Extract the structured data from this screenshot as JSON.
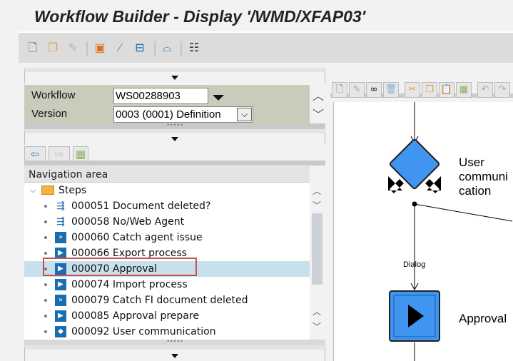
{
  "title": "Workflow Builder - Display '/WMD/XFAP03'",
  "toolbar": {
    "icons": [
      "new-icon",
      "copy-icon",
      "glasses-edit-icon",
      "object-link-icon",
      "wand-icon",
      "binding-icon",
      "hat-icon",
      "layout-icon"
    ]
  },
  "form": {
    "workflow_label": "Workflow",
    "workflow_value": "WS00288903",
    "version_label": "Version",
    "version_value": "0003 (0001) Definition"
  },
  "navigation": {
    "header": "Navigation area",
    "root": "Steps",
    "selected_index": 4,
    "steps": [
      {
        "label": "000051 Document deleted?",
        "icon": "branch-icon"
      },
      {
        "label": "000058 No/Web Agent",
        "icon": "branch-icon"
      },
      {
        "label": "000060 Catch agent issue",
        "icon": "event-icon"
      },
      {
        "label": "000066 Export process",
        "icon": "activity-icon"
      },
      {
        "label": "000070 Approval",
        "icon": "activity-icon"
      },
      {
        "label": "000074 Import process",
        "icon": "activity-icon"
      },
      {
        "label": "000079 Catch FI document deleted",
        "icon": "event-icon"
      },
      {
        "label": "000085 Approval prepare",
        "icon": "activity-icon"
      },
      {
        "label": "000092 User communication",
        "icon": "user-decision-icon"
      }
    ]
  },
  "canvas": {
    "node1_line1": "User",
    "node1_line2": "communication",
    "edge_label": "Dialog",
    "node2": "Approval",
    "accent": "#3f95f0"
  }
}
